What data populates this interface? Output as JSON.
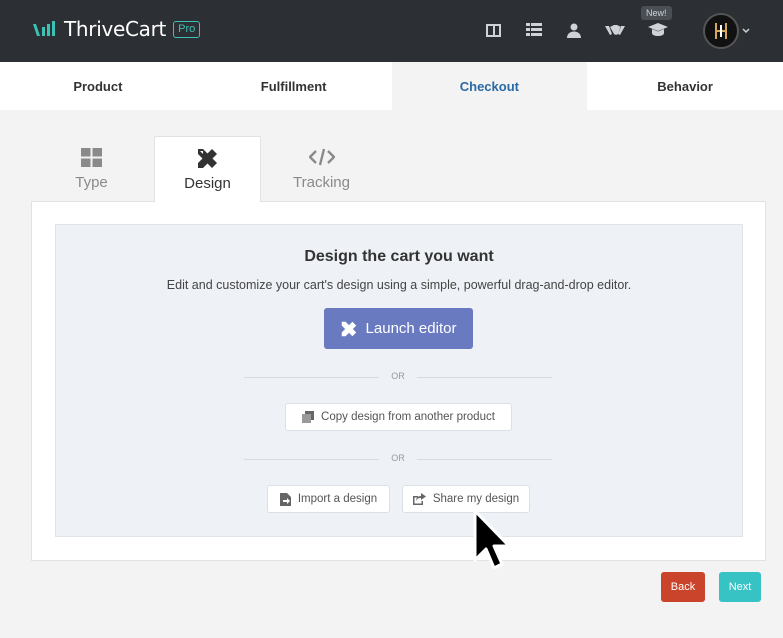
{
  "app": {
    "name": "ThriveCart",
    "badge": "Pro"
  },
  "topnav": {
    "icons": [
      "layout-icon",
      "list-icon",
      "user-icon",
      "handshake-icon",
      "graduation-cap-icon"
    ],
    "new_badge": "New!",
    "avatar_text": "H"
  },
  "steps": [
    {
      "label": "Product",
      "active": false
    },
    {
      "label": "Fulfillment",
      "active": false
    },
    {
      "label": "Checkout",
      "active": true
    },
    {
      "label": "Behavior",
      "active": false
    }
  ],
  "subtabs": [
    {
      "label": "Type",
      "icon": "grid-icon",
      "active": false
    },
    {
      "label": "Design",
      "icon": "pencil-ruler-icon",
      "active": true
    },
    {
      "label": "Tracking",
      "icon": "code-icon",
      "active": false
    }
  ],
  "design": {
    "title": "Design the cart you want",
    "description": "Edit and customize your cart's design using a simple, powerful drag-and-drop editor.",
    "launch_label": "Launch editor",
    "or_label": "OR",
    "copy_label": "Copy design from another product",
    "import_label": "Import a design",
    "share_label": "Share my design"
  },
  "footer": {
    "back_label": "Back",
    "next_label": "Next"
  },
  "colors": {
    "topbar": "#2c2f33",
    "accent_teal": "#3cc2b3",
    "active_step": "#2a6aa5",
    "launch": "#6a7ac0",
    "back": "#c9442a",
    "next": "#37c2c4"
  }
}
